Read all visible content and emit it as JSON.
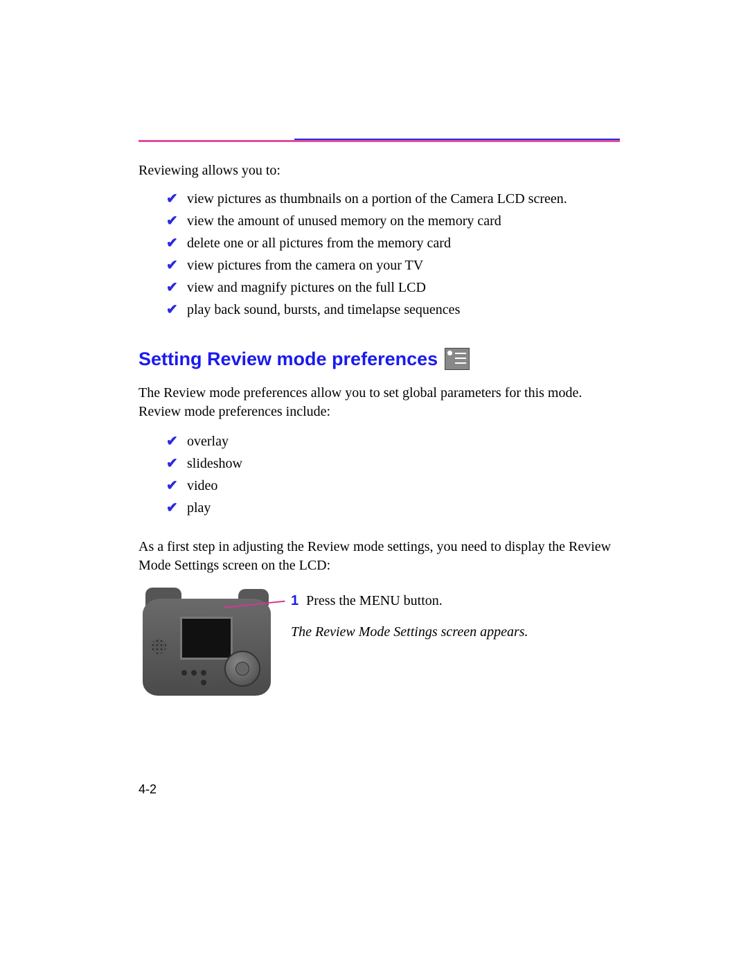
{
  "intro": "Reviewing allows you to:",
  "features": [
    "view pictures as thumbnails on a portion of the Camera LCD screen.",
    "view the amount of unused memory on the memory card",
    "delete one or all pictures from the memory card",
    "view pictures from the camera on your TV",
    "view and magnify pictures on the full LCD",
    "play back sound, bursts, and timelapse sequences"
  ],
  "section_heading": "Setting Review mode preferences",
  "section_para": "The Review mode preferences allow you to set global parameters for this mode. Review mode preferences include:",
  "prefs": [
    "overlay",
    "slideshow",
    "video",
    "play"
  ],
  "lead_in": "As a first step in adjusting the Review mode settings, you need to display the Review Mode Settings screen on the LCD:",
  "step": {
    "num": "1",
    "instruction": "Press the MENU button.",
    "result": "The Review Mode Settings screen appears."
  },
  "page_number": "4-2"
}
